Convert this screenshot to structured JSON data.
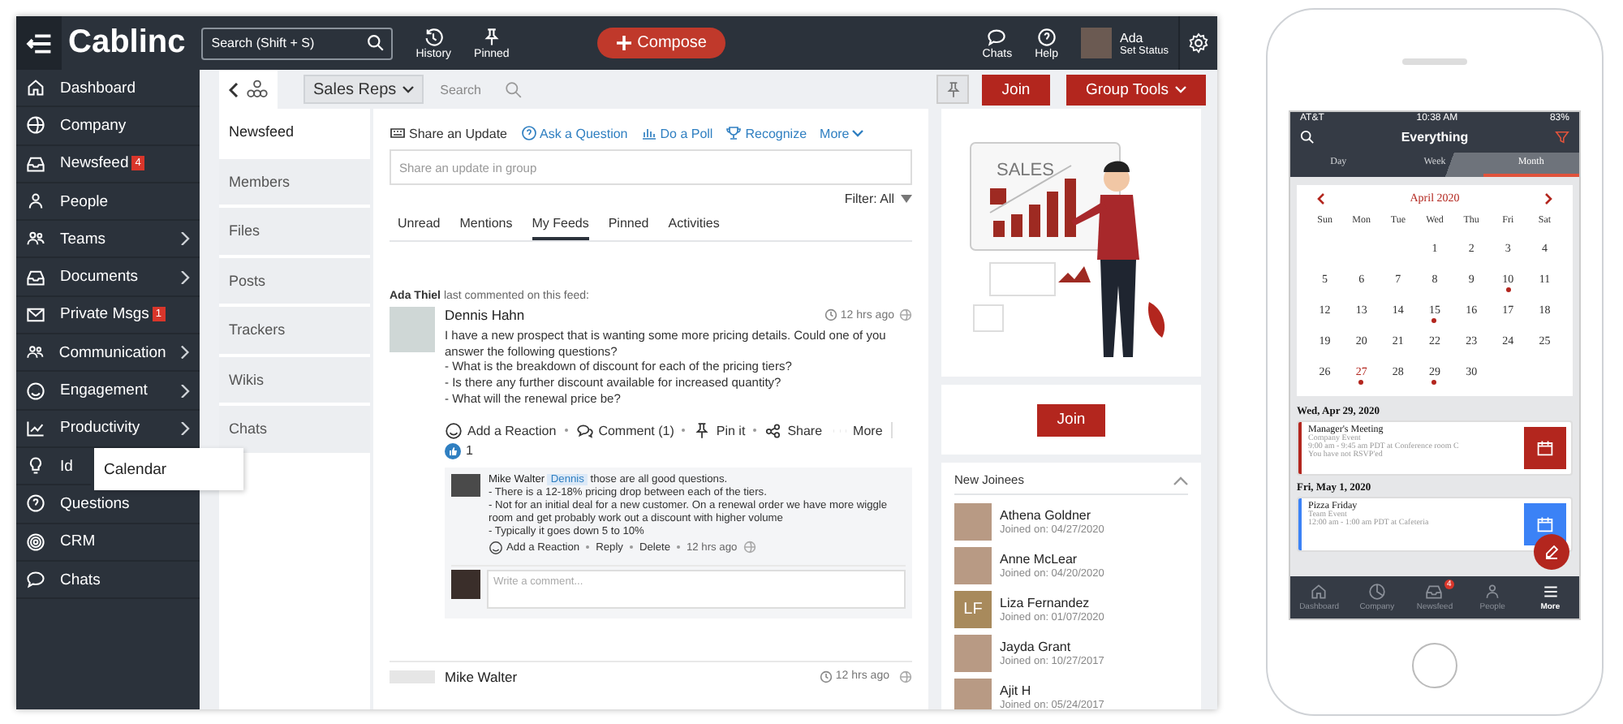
{
  "topbar": {
    "logo": "Cablinc",
    "search_placeholder": "Search (Shift + S)",
    "tools": [
      {
        "label": "History"
      },
      {
        "label": "Pinned"
      }
    ],
    "compose": "Compose",
    "right_tools": [
      {
        "label": "Chats"
      },
      {
        "label": "Help"
      }
    ],
    "user": {
      "name": "Ada",
      "status": "Set Status"
    }
  },
  "sidebar": {
    "items": [
      {
        "label": "Dashboard",
        "expandable": false
      },
      {
        "label": "Company",
        "expandable": false
      },
      {
        "label": "Newsfeed",
        "expandable": false,
        "badge": "4"
      },
      {
        "label": "People",
        "expandable": false
      },
      {
        "label": "Teams",
        "expandable": true
      },
      {
        "label": "Documents",
        "expandable": true
      },
      {
        "label": "Private Msgs",
        "expandable": false,
        "badge": "1"
      },
      {
        "label": "Communication",
        "expandable": true
      },
      {
        "label": "Engagement",
        "expandable": true
      },
      {
        "label": "Productivity",
        "expandable": true
      },
      {
        "label": "Id",
        "flyout": "Calendar"
      },
      {
        "label": "Questions",
        "expandable": false
      },
      {
        "label": "CRM",
        "expandable": false
      },
      {
        "label": "Chats",
        "expandable": false
      }
    ]
  },
  "group": {
    "name": "Sales Reps",
    "search_placeholder": "Search",
    "join": "Join",
    "tools": "Group Tools"
  },
  "group_nav": [
    {
      "label": "Newsfeed",
      "selected": true
    },
    {
      "label": "Members",
      "selected": false
    },
    {
      "label": "Files",
      "selected": false
    },
    {
      "label": "Posts",
      "selected": false
    },
    {
      "label": "Trackers",
      "selected": false
    },
    {
      "label": "Wikis",
      "selected": false
    },
    {
      "label": "Chats",
      "selected": false
    }
  ],
  "composer": {
    "actions": [
      {
        "label": "Share an Update",
        "selected": true
      },
      {
        "label": "Ask a Question",
        "selected": false
      },
      {
        "label": "Do a Poll",
        "selected": false
      },
      {
        "label": "Recognize",
        "selected": false
      }
    ],
    "more": "More",
    "placeholder": "Share an update in group"
  },
  "filter": {
    "label": "Filter:",
    "value": "All"
  },
  "feed_tabs": [
    {
      "label": "Unread",
      "selected": false
    },
    {
      "label": "Mentions",
      "selected": false
    },
    {
      "label": "My Feeds",
      "selected": true
    },
    {
      "label": "Pinned",
      "selected": false
    },
    {
      "label": "Activities",
      "selected": false
    }
  ],
  "post": {
    "commenter": "Ada Thiel",
    "activity": "last commented on this feed:",
    "author": "Dennis Hahn",
    "time": "12 hrs ago",
    "body": "I have a new prospect that is wanting some more pricing details. Could one of you answer the following questions?\n- What is the breakdown of discount for each of the pricing tiers?\n- Is there any further discount available for increased quantity?\n- What will the renewal price be?",
    "actions": [
      "Add a Reaction",
      "Comment (1)",
      "Pin it",
      "Share",
      "More"
    ],
    "likes": "1",
    "comment": {
      "author": "Mike Walter",
      "mention": "Dennis",
      "text": "those are all good questions.\n- There is a 12-18% pricing drop between each of the tiers.\n- Not for an initial deal for a new customer. On a renewal order we have more wiggle room and get probably work out a discount with higher volume\n- Typically it goes down 5 to 10%",
      "actions": [
        "Add a Reaction",
        "Reply",
        "Delete"
      ],
      "time": "12 hrs ago"
    },
    "reply_placeholder": "Write a comment..."
  },
  "next_post": {
    "author": "Mike Walter",
    "time": "12 hrs ago"
  },
  "promo": {
    "title": "SALES",
    "join": "Join"
  },
  "joinees": {
    "title": "New Joinees",
    "expanded": true,
    "items": [
      {
        "name": "Athena Goldner",
        "joined": "Joined on: 04/27/2020"
      },
      {
        "name": "Anne McLear",
        "joined": "Joined on: 04/20/2020"
      },
      {
        "name": "Liza Fernandez",
        "joined": "Joined on: 01/07/2020",
        "initials": "LF"
      },
      {
        "name": "Jayda Grant",
        "joined": "Joined on: 10/27/2017"
      },
      {
        "name": "Ajit H",
        "joined": "Joined on: 05/24/2017"
      }
    ]
  },
  "phone": {
    "carrier": "AT&T",
    "clock": "10:38 AM",
    "battery": "83%",
    "title": "Everything",
    "tabs": [
      {
        "label": "Day",
        "selected": false
      },
      {
        "label": "Week",
        "selected": false
      },
      {
        "label": "Month",
        "selected": true
      }
    ],
    "month": "April 2020",
    "weekdays": [
      "Sun",
      "Mon",
      "Tue",
      "Wed",
      "Thu",
      "Fri",
      "Sat"
    ],
    "weeks": [
      [
        {
          "label": "1",
          "event": false,
          "today": false
        },
        {
          "label": "2",
          "event": false,
          "today": false
        },
        {
          "label": "3",
          "event": false,
          "today": false
        },
        {
          "label": "4",
          "event": false,
          "today": false
        }
      ],
      [
        {
          "label": "5",
          "event": false,
          "today": false
        },
        {
          "label": "6",
          "event": false,
          "today": false
        },
        {
          "label": "7",
          "event": false,
          "today": false
        },
        {
          "label": "8",
          "event": false,
          "today": false
        },
        {
          "label": "9",
          "event": false,
          "today": false
        },
        {
          "label": "10",
          "event": true,
          "today": false
        },
        {
          "label": "11",
          "event": false,
          "today": false
        }
      ],
      [
        {
          "label": "12",
          "event": false,
          "today": false
        },
        {
          "label": "13",
          "event": false,
          "today": false
        },
        {
          "label": "14",
          "event": false,
          "today": false
        },
        {
          "label": "15",
          "event": true,
          "today": false
        },
        {
          "label": "16",
          "event": false,
          "today": false
        },
        {
          "label": "17",
          "event": false,
          "today": false
        },
        {
          "label": "18",
          "event": false,
          "today": false
        }
      ],
      [
        {
          "label": "19",
          "event": false,
          "today": false
        },
        {
          "label": "20",
          "event": false,
          "today": false
        },
        {
          "label": "21",
          "event": false,
          "today": false
        },
        {
          "label": "22",
          "event": false,
          "today": false
        },
        {
          "label": "23",
          "event": false,
          "today": false
        },
        {
          "label": "24",
          "event": false,
          "today": false
        },
        {
          "label": "25",
          "event": false,
          "today": false
        }
      ],
      [
        {
          "label": "26",
          "event": false,
          "today": false
        },
        {
          "label": "27",
          "event": true,
          "today": true
        },
        {
          "label": "28",
          "event": false,
          "today": false
        },
        {
          "label": "29",
          "event": true,
          "today": false
        },
        {
          "label": "30",
          "event": false,
          "today": false
        }
      ]
    ],
    "events": [
      {
        "date": "Wed, Apr 29, 2020",
        "title": "Manager's Meeting",
        "type": "Company Event",
        "time": "9:00 am - 9:45 am PDT at Conference room C",
        "note": "You have not RSVP'ed",
        "color": "#b3261e"
      },
      {
        "date": "Fri, May 1, 2020",
        "title": "Pizza Friday",
        "type": "Team Event",
        "time": "12:00 am - 1:00 am PDT at Cafeteria",
        "color": "#3b82f6"
      }
    ],
    "nav": [
      {
        "label": "Dashboard",
        "selected": false
      },
      {
        "label": "Company",
        "selected": false
      },
      {
        "label": "Newsfeed",
        "selected": false,
        "badge": "4"
      },
      {
        "label": "People",
        "selected": false
      },
      {
        "label": "More",
        "selected": true
      }
    ]
  }
}
